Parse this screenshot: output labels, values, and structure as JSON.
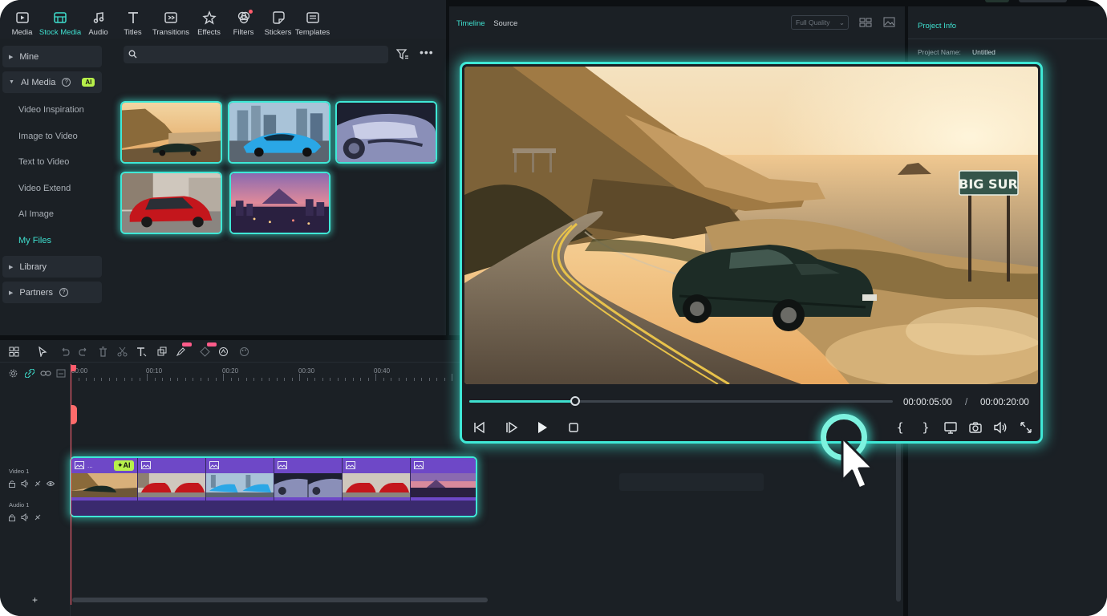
{
  "toolbar": {
    "tools": [
      {
        "label": "Media",
        "icon": "media-icon"
      },
      {
        "label": "Stock Media",
        "icon": "stock-media-icon",
        "active": true
      },
      {
        "label": "Audio",
        "icon": "audio-note-icon"
      },
      {
        "label": "Titles",
        "icon": "titles-t-icon"
      },
      {
        "label": "Transitions",
        "icon": "transitions-icon"
      },
      {
        "label": "Effects",
        "icon": "effects-star-icon"
      },
      {
        "label": "Filters",
        "icon": "filters-icon"
      },
      {
        "label": "Stickers",
        "icon": "stickers-icon"
      },
      {
        "label": "Templates",
        "icon": "templates-icon"
      }
    ]
  },
  "left_nav": {
    "mine": "Mine",
    "ai_media": "AI Media",
    "ai_badge": "AI",
    "sub_items": [
      "Video Inspiration",
      "Image to Video",
      "Text to Video",
      "Video Extend",
      "AI Image",
      "My Files"
    ],
    "active_sub": "My Files",
    "library": "Library",
    "partners": "Partners"
  },
  "preview_header": {
    "tab_timeline": "Timeline",
    "tab_source": "Source",
    "quality": "Full Quality"
  },
  "project": {
    "title": "Project Info",
    "name_label": "Project Name:",
    "name_value": "Untitled"
  },
  "player": {
    "current_time": "00:00:05:00",
    "separator": "/",
    "total_time": "00:00:20:00",
    "progress_fraction": 0.25,
    "sign_text": "BIG SUR"
  },
  "timeline": {
    "ruler": [
      "00:00",
      "00:10",
      "00:20",
      "00:30",
      "00:40"
    ],
    "video_track": "Video 1",
    "audio_track": "Audio 1",
    "ai_tag": "✦AI",
    "clip_dots": "...",
    "add": "+"
  },
  "colors": {
    "accent": "#3fe0cf",
    "glow": "#3fe8d6",
    "clip": "#6e48c7",
    "ai_badge": "#b7f04a",
    "playhead": "#ff5c6c"
  }
}
